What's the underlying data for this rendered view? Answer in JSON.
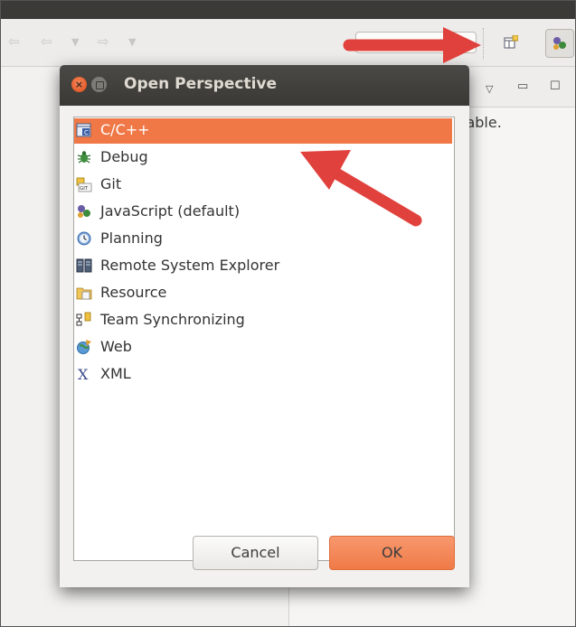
{
  "dialog": {
    "title": "Open Perspective",
    "items": [
      {
        "label": "C/C++",
        "icon": "cpp-perspective-icon",
        "selected": true
      },
      {
        "label": "Debug",
        "icon": "bug-icon",
        "selected": false
      },
      {
        "label": "Git",
        "icon": "git-icon",
        "selected": false
      },
      {
        "label": "JavaScript (default)",
        "icon": "javascript-perspective-icon",
        "selected": false
      },
      {
        "label": "Planning",
        "icon": "clock-icon",
        "selected": false
      },
      {
        "label": "Remote System Explorer",
        "icon": "remote-system-icon",
        "selected": false
      },
      {
        "label": "Resource",
        "icon": "folder-icon",
        "selected": false
      },
      {
        "label": "Team Synchronizing",
        "icon": "sync-icon",
        "selected": false
      },
      {
        "label": "Web",
        "icon": "web-icon",
        "selected": false
      },
      {
        "label": "XML",
        "icon": "xml-icon",
        "selected": false
      }
    ],
    "cancel_label": "Cancel",
    "ok_label": "OK"
  },
  "background": {
    "partial_text": "lable."
  },
  "colors": {
    "selection": "#f07746",
    "ok_button": "#f07a47",
    "annotation_arrow": "#e0413c"
  }
}
